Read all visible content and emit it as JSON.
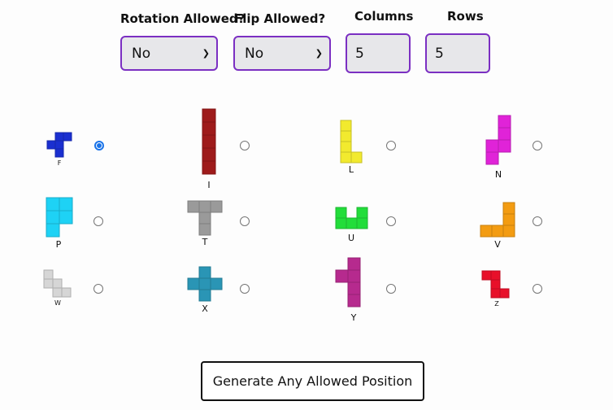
{
  "controls": {
    "rotation": {
      "label": "Rotation Allowed?",
      "value": "No"
    },
    "flip": {
      "label": "Flip Allowed?",
      "value": "No"
    },
    "columns": {
      "label": "Columns",
      "value": "5"
    },
    "rows": {
      "label": "Rows",
      "value": "5"
    }
  },
  "pieces": [
    {
      "name": "F",
      "color": "#1a2fd0",
      "cells": [
        [
          1,
          0
        ],
        [
          2,
          0
        ],
        [
          0,
          1
        ],
        [
          1,
          1
        ],
        [
          1,
          2
        ]
      ],
      "selected": true
    },
    {
      "name": "I",
      "color": "#9e1b1b",
      "cells": [
        [
          0,
          0
        ],
        [
          0,
          1
        ],
        [
          0,
          2
        ],
        [
          0,
          3
        ],
        [
          0,
          4
        ]
      ],
      "selected": false
    },
    {
      "name": "L",
      "color": "#f2ea2e",
      "cells": [
        [
          0,
          0
        ],
        [
          0,
          1
        ],
        [
          0,
          2
        ],
        [
          0,
          3
        ],
        [
          1,
          3
        ]
      ],
      "selected": false
    },
    {
      "name": "N",
      "color": "#e023d8",
      "cells": [
        [
          1,
          0
        ],
        [
          1,
          1
        ],
        [
          0,
          2
        ],
        [
          1,
          2
        ],
        [
          0,
          3
        ]
      ],
      "selected": false
    },
    {
      "name": "P",
      "color": "#1ed2f5",
      "cells": [
        [
          0,
          0
        ],
        [
          1,
          0
        ],
        [
          0,
          1
        ],
        [
          1,
          1
        ],
        [
          0,
          2
        ]
      ],
      "selected": false
    },
    {
      "name": "T",
      "color": "#9a9a9a",
      "cells": [
        [
          0,
          0
        ],
        [
          1,
          0
        ],
        [
          2,
          0
        ],
        [
          1,
          1
        ],
        [
          1,
          2
        ]
      ],
      "selected": false
    },
    {
      "name": "U",
      "color": "#22dd3a",
      "cells": [
        [
          0,
          0
        ],
        [
          2,
          0
        ],
        [
          0,
          1
        ],
        [
          1,
          1
        ],
        [
          2,
          1
        ]
      ],
      "selected": false
    },
    {
      "name": "V",
      "color": "#f39c12",
      "cells": [
        [
          2,
          0
        ],
        [
          2,
          1
        ],
        [
          0,
          2
        ],
        [
          1,
          2
        ],
        [
          2,
          2
        ]
      ],
      "selected": false
    },
    {
      "name": "W",
      "color": "#d6d6d6",
      "cells": [
        [
          0,
          0
        ],
        [
          0,
          1
        ],
        [
          1,
          1
        ],
        [
          1,
          2
        ],
        [
          2,
          2
        ]
      ],
      "selected": false
    },
    {
      "name": "X",
      "color": "#2a95b5",
      "cells": [
        [
          1,
          0
        ],
        [
          0,
          1
        ],
        [
          1,
          1
        ],
        [
          2,
          1
        ],
        [
          1,
          2
        ]
      ],
      "selected": false
    },
    {
      "name": "Y",
      "color": "#b62a8e",
      "cells": [
        [
          1,
          0
        ],
        [
          0,
          1
        ],
        [
          1,
          1
        ],
        [
          1,
          2
        ],
        [
          1,
          3
        ]
      ],
      "selected": false
    },
    {
      "name": "Z",
      "color": "#e8102a",
      "cells": [
        [
          0,
          0
        ],
        [
          1,
          0
        ],
        [
          1,
          1
        ],
        [
          1,
          2
        ],
        [
          2,
          2
        ]
      ],
      "selected": false
    }
  ],
  "generate_button": "Generate Any Allowed Position"
}
